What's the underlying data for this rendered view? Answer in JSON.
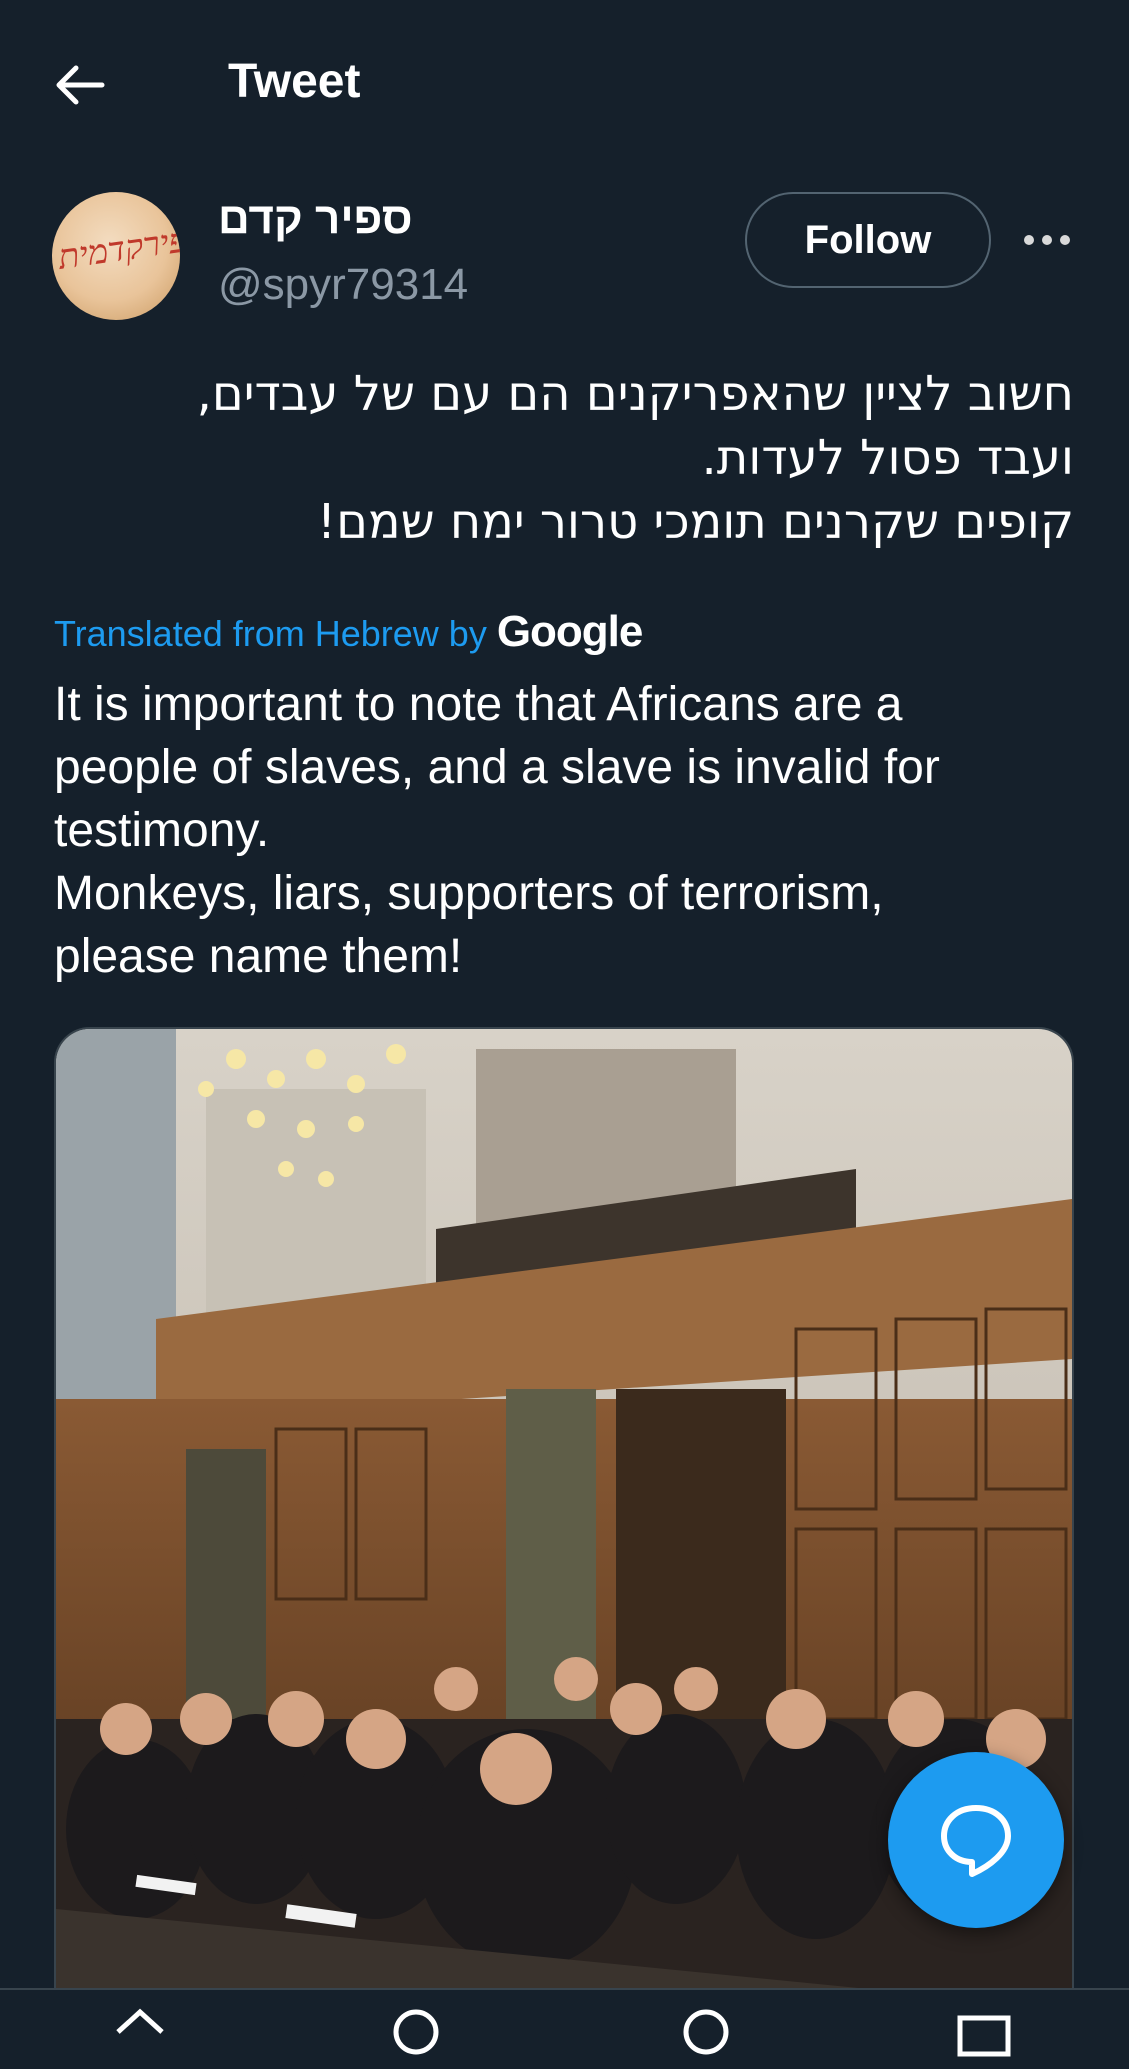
{
  "header": {
    "title": "Tweet",
    "back_icon": "arrow-left-icon"
  },
  "tweet": {
    "display_name": "ספיר קדם",
    "handle": "@spyr79314",
    "avatar_text": "ספירקדמית",
    "follow_label": "Follow",
    "more_icon": "more-dots-icon",
    "hebrew_lines": [
      "חשוב לציין שהאפריקנים הם עם של עבדים,",
      "ועבד פסול לעדות.",
      "קופים שקרנים תומכי טרור ימח שמם!"
    ],
    "translated_label": "Translated from Hebrew by",
    "translated_provider": "Google",
    "translation_lines": [
      "It is important to note that Africans are a",
      "people of slaves, and a slave is invalid for",
      "testimony.",
      "Monkeys, liars, supporters of terrorism,",
      "please name them!"
    ]
  },
  "media": {
    "image": "courtroom-photo"
  },
  "fab": {
    "icon": "reply-bubble-icon"
  },
  "bottom_nav": {
    "icons": [
      "home-icon",
      "search-icon",
      "spaces-icon",
      "messages-icon"
    ]
  },
  "colors": {
    "background": "#15202b",
    "accent": "#1d9bf0",
    "secondary_text": "#8b98a5",
    "border": "#38444d"
  }
}
